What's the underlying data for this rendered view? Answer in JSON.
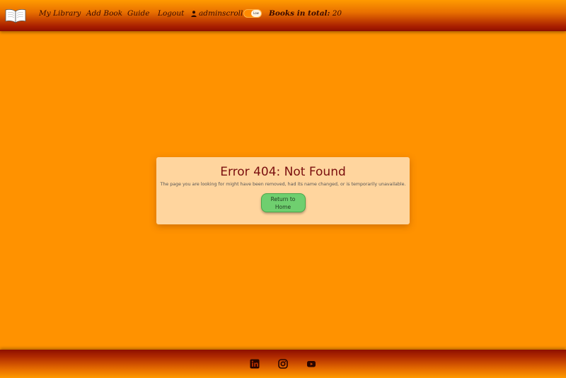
{
  "navbar": {
    "links": {
      "my_library": "My Library",
      "add_book": "Add Book",
      "guide": "Guide",
      "logout": "Logout"
    },
    "username": "adminscroll",
    "toggle_label": "Low",
    "books_total_label": "Books in total:",
    "books_total_count": "20"
  },
  "error": {
    "title": "Error 404: Not Found",
    "message": "The page you are looking for might have been removed, had its name changed, or is temporarily unavailable.",
    "button_line1": "Return to",
    "button_line2": "Home"
  },
  "footer": {
    "icons": [
      "linkedin-icon",
      "instagram-icon",
      "youtube-icon"
    ]
  },
  "colors": {
    "background": "#ff9200",
    "card": "#ffd59e",
    "title": "#7a0f0f",
    "button": "#6fcf6f"
  }
}
